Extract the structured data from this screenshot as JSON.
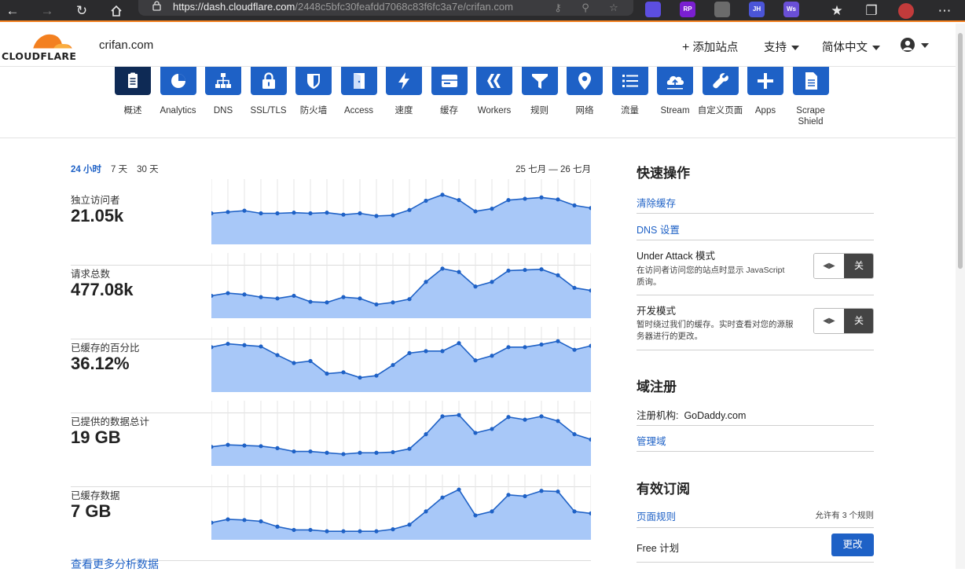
{
  "browser": {
    "url_host": "https://dash.cloudflare.com",
    "url_path": "/2448c5bfc30feafdd7068c83f6fc3a7e/crifan.com",
    "extensions": [
      {
        "name": "react-ext-icon",
        "label": "",
        "color": "#5c4ee0"
      },
      {
        "name": "rp-ext-icon",
        "label": "RP",
        "color": "#7a1fd1"
      },
      {
        "name": "qr-ext-icon",
        "label": "",
        "color": "#6b6b6b"
      },
      {
        "name": "jh-ext-icon",
        "label": "JH",
        "color": "#4b55d8"
      },
      {
        "name": "ws-ext-icon",
        "label": "Ws",
        "color": "#6a4fd6"
      }
    ]
  },
  "header": {
    "logo_text": "CLOUDFLARE",
    "site": "crifan.com",
    "add_site": "添加站点",
    "support": "支持",
    "language": "简体中文"
  },
  "nav": [
    {
      "label": "概述",
      "icon": "overview-icon",
      "active": true
    },
    {
      "label": "Analytics",
      "icon": "analytics-icon"
    },
    {
      "label": "DNS",
      "icon": "dns-icon"
    },
    {
      "label": "SSL/TLS",
      "icon": "lock-icon"
    },
    {
      "label": "防火墙",
      "icon": "shield-icon"
    },
    {
      "label": "Access",
      "icon": "door-icon"
    },
    {
      "label": "速度",
      "icon": "lightning-icon"
    },
    {
      "label": "缓存",
      "icon": "drive-icon"
    },
    {
      "label": "Workers",
      "icon": "workers-icon"
    },
    {
      "label": "规则",
      "icon": "filter-icon"
    },
    {
      "label": "网络",
      "icon": "location-pin-icon"
    },
    {
      "label": "流量",
      "icon": "list-icon"
    },
    {
      "label": "Stream",
      "icon": "cloud-upload-icon"
    },
    {
      "label": "自定义页面",
      "icon": "wrench-icon"
    },
    {
      "label": "Apps",
      "icon": "plus-icon"
    },
    {
      "label": "Scrape\nShield",
      "icon": "document-icon"
    }
  ],
  "analytics": {
    "ranges": [
      {
        "label": "24 小时",
        "active": true
      },
      {
        "label": "7 天",
        "active": false
      },
      {
        "label": "30 天",
        "active": false
      }
    ],
    "date_range": "25 七月 — 26 七月",
    "metrics": [
      {
        "label": "独立访问者",
        "value": "21.05k",
        "series": [
          35,
          37,
          39,
          35,
          35,
          36,
          35,
          36,
          33,
          35,
          31,
          32,
          40,
          54,
          63,
          55,
          38,
          42,
          55,
          57,
          59,
          56,
          47,
          43
        ]
      },
      {
        "label": "请求总数",
        "value": "477.08k",
        "series": [
          22,
          26,
          24,
          20,
          18,
          22,
          13,
          12,
          20,
          18,
          9,
          12,
          17,
          43,
          63,
          58,
          36,
          43,
          60,
          61,
          62,
          53,
          34,
          30
        ]
      },
      {
        "label": "已缓存的百分比",
        "value": "36.12%",
        "series": [
          56,
          61,
          59,
          57,
          44,
          32,
          35,
          16,
          18,
          10,
          13,
          29,
          47,
          50,
          50,
          62,
          36,
          43,
          56,
          56,
          60,
          65,
          52,
          58
        ]
      },
      {
        "label": "已提供的数据总计",
        "value": "19 GB",
        "series": [
          17,
          20,
          19,
          18,
          15,
          10,
          10,
          8,
          6,
          8,
          8,
          9,
          14,
          36,
          63,
          65,
          38,
          44,
          62,
          58,
          63,
          56,
          36,
          28
        ]
      },
      {
        "label": "已缓存数据",
        "value": "7 GB",
        "series": [
          14,
          19,
          18,
          16,
          8,
          3,
          3,
          1,
          1,
          1,
          1,
          4,
          11,
          31,
          52,
          64,
          25,
          31,
          56,
          54,
          62,
          61,
          31,
          28
        ]
      }
    ],
    "more_link": "查看更多分析数据"
  },
  "quick_actions": {
    "title": "快速操作",
    "purge_cache": "清除缓存",
    "dns_settings": "DNS 设置",
    "under_attack": {
      "title": "Under Attack 模式",
      "desc": "在访问者访问您的站点时显示 JavaScript 质询。",
      "state": "关"
    },
    "dev_mode": {
      "title": "开发模式",
      "desc": "暂时绕过我们的缓存。实时查看对您的源服务器进行的更改。",
      "state": "关"
    }
  },
  "registrar": {
    "title": "域注册",
    "label": "注册机构:",
    "value": "GoDaddy.com",
    "manage": "管理域"
  },
  "subscriptions": {
    "title": "有效订阅",
    "page_rules": "页面规则",
    "rules_allowed": "允许有 3 个规则",
    "plan": "Free 计划",
    "update": "更改"
  },
  "colors": {
    "accent": "#1e61c6",
    "active_nav": "#0e2a55",
    "chart_fill": "#a8c8f8",
    "cf_orange": "#f38020"
  }
}
